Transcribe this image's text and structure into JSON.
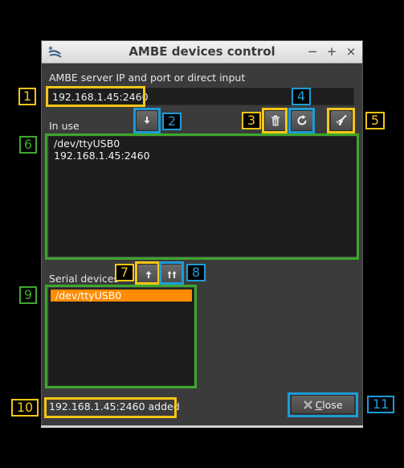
{
  "window": {
    "title": "AMBE devices control",
    "app_icon": "sdrangel-logo-icon",
    "minimize_glyph": "−",
    "maximize_glyph": "+",
    "close_glyph": "×"
  },
  "server": {
    "label": "AMBE server IP and port or direct input",
    "value": "192.168.1.45:2460"
  },
  "in_use": {
    "label": "In use",
    "items": [
      "/dev/ttyUSB0",
      "192.168.1.45:2460"
    ]
  },
  "serial": {
    "label": "Serial devices",
    "items": [
      "/dev/ttyUSB0"
    ],
    "selected_index": 0
  },
  "buttons": {
    "import_icon": "arrow-down-icon",
    "remove_icon": "trash-icon",
    "refresh_icon": "refresh-icon",
    "clear_icon": "broom-icon",
    "import_serial_icon": "arrow-up-icon",
    "import_all_icon": "double-arrow-up-icon",
    "close_label_accel": "C",
    "close_label_rest": "lose",
    "close_icon": "close-x-icon"
  },
  "status": {
    "text": "192.168.1.45:2460 added"
  },
  "callouts": [
    "1",
    "2",
    "3",
    "4",
    "5",
    "6",
    "7",
    "8",
    "9",
    "10",
    "11"
  ],
  "colors": {
    "callout_yellow": "#f5c518",
    "callout_blue": "#1e9bd7",
    "callout_green": "#3da82c",
    "selection": "#ff8c00"
  }
}
